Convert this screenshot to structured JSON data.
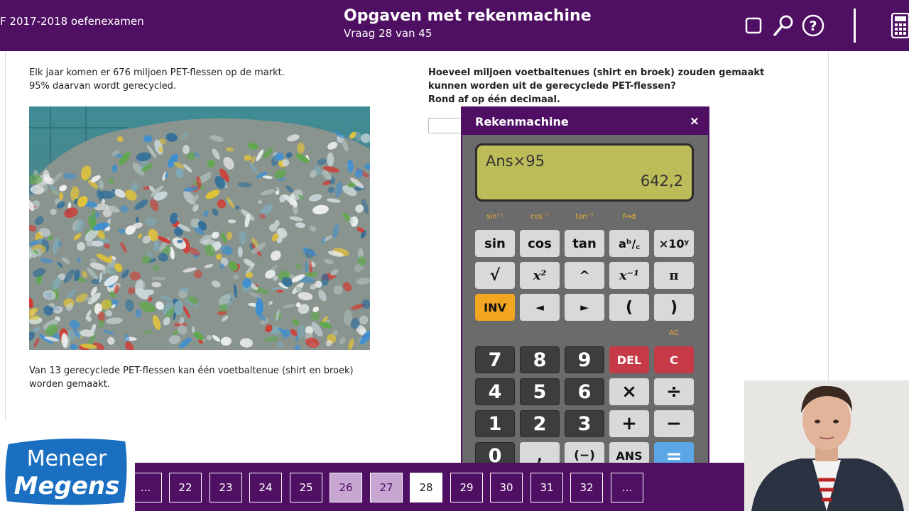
{
  "header": {
    "exam_name": "F 2017-2018 oefenexamen",
    "title": "Opgaven met rekenmachine",
    "subtitle": "Vraag 28 van 45",
    "icons": [
      "square-icon",
      "search-icon",
      "help-icon",
      "calculator-icon"
    ]
  },
  "content": {
    "intro_line1": "Elk jaar komen er 676 miljoen PET-flessen op de markt.",
    "intro_line2": "95% daarvan wordt gerecycled.",
    "note_text": "Van 13 gerecyclede PET-flessen kan één voetbaltenue (shirt en broek) worden gemaakt.",
    "question_text": "Hoeveel miljoen voetbaltenues (shirt en broek) zouden gemaakt kunnen worden uit de gerecyclede PET-flessen?",
    "question_instruction": "Rond af op één decimaal.",
    "answer_value": ""
  },
  "calculator": {
    "title": "Rekenmachine",
    "close_label": "×",
    "expression": "Ans×95",
    "result": "642,2",
    "shift_labels": [
      "sin⁻¹",
      "cos⁻¹",
      "tan⁻¹",
      "f↔d"
    ],
    "ac_label": "AC",
    "row1": [
      "sin",
      "cos",
      "tan",
      "aᵇ/꜀",
      "×10ʸ"
    ],
    "row2": [
      "√",
      "x²",
      "^",
      "x⁻¹",
      "π"
    ],
    "row3": [
      "INV",
      "◄",
      "►",
      "(",
      ")"
    ],
    "row4": [
      "7",
      "8",
      "9",
      "DEL",
      "C"
    ],
    "row5": [
      "4",
      "5",
      "6",
      "×",
      "÷"
    ],
    "row6": [
      "1",
      "2",
      "3",
      "+",
      "−"
    ],
    "row7": [
      "0",
      ",",
      "(−)",
      "ANS",
      "="
    ]
  },
  "pagination": {
    "pages": [
      "...",
      "22",
      "23",
      "24",
      "25",
      "26",
      "27",
      "28",
      "29",
      "30",
      "31",
      "32",
      "..."
    ],
    "current": "28",
    "visited": [
      "26",
      "27"
    ]
  },
  "logo": {
    "line1": "Meneer",
    "line2": "Megens"
  },
  "colors": {
    "brand_purple": "#4f0f63",
    "display_green": "#bcbc59",
    "key_red": "#c53a46",
    "key_orange": "#f2a520",
    "key_blue": "#5aa6e6"
  }
}
